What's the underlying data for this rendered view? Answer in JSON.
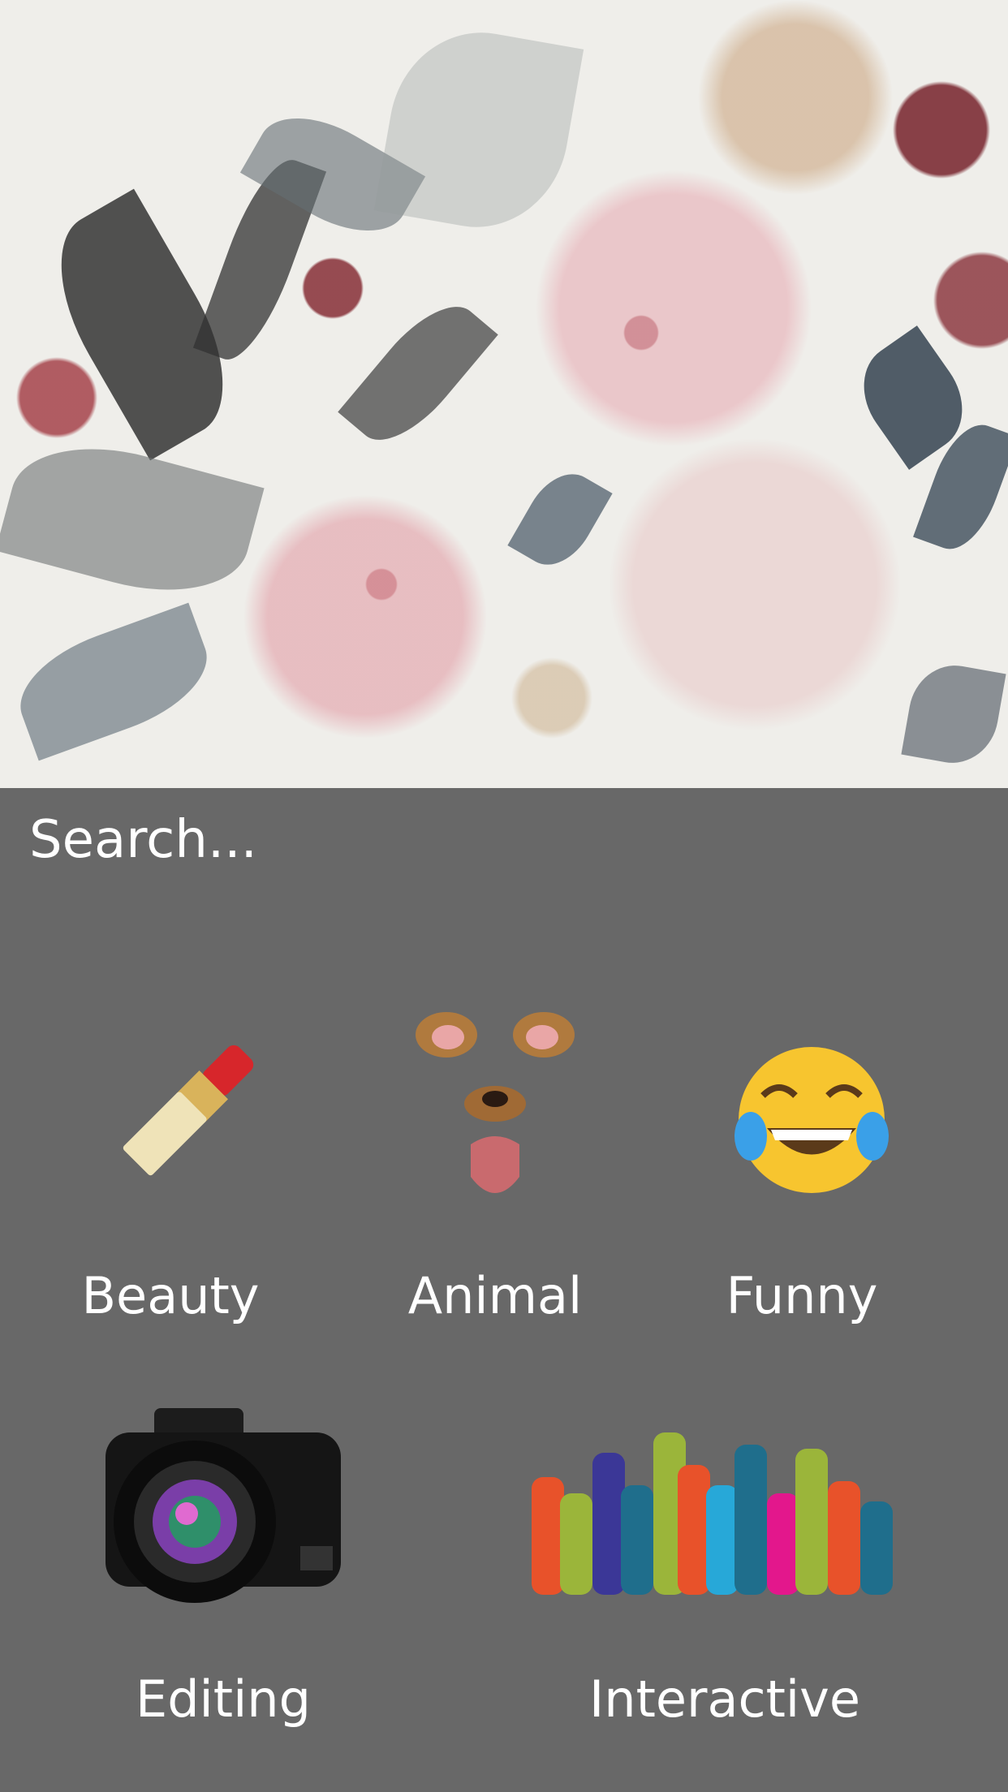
{
  "search": {
    "placeholder": "Search..."
  },
  "categories": [
    {
      "label": "Beauty",
      "icon": "lipstick-icon"
    },
    {
      "label": "Animal",
      "icon": "dog-face-filter-icon"
    },
    {
      "label": "Funny",
      "icon": "tears-of-joy-icon"
    },
    {
      "label": "Editing",
      "icon": "camera-icon"
    },
    {
      "label": "Interactive",
      "icon": "raised-hands-icon"
    }
  ]
}
